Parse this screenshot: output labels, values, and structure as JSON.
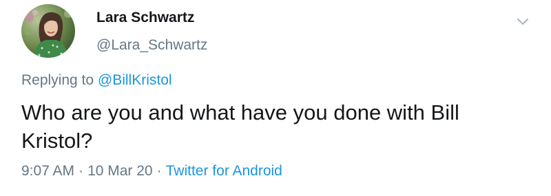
{
  "tweet": {
    "author": {
      "display_name": "Lara Schwartz",
      "handle": "@Lara_Schwartz"
    },
    "reply": {
      "prefix": "Replying to",
      "mention": "@BillKristol"
    },
    "text": "Who are you and what have you done with Bill Kristol?",
    "time": "9:07 AM",
    "separator": "·",
    "date": "10 Mar 20",
    "source": "Twitter for Android"
  },
  "icons": {
    "menu": "chevron-down-icon"
  },
  "colors": {
    "text_primary": "#14171a",
    "text_secondary": "#657786",
    "link": "#1b95e0",
    "chevron": "#aab8c2"
  }
}
